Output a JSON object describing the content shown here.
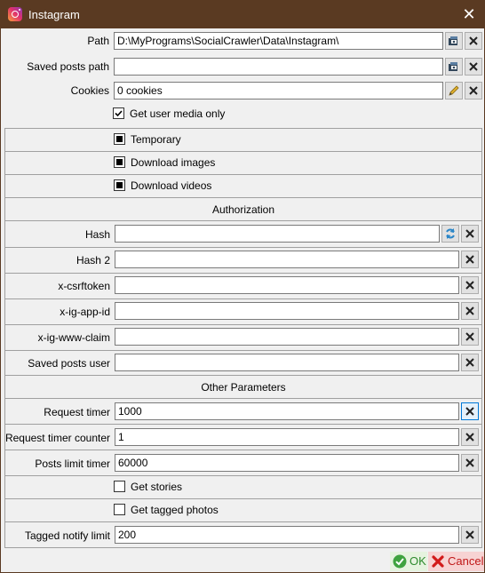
{
  "window": {
    "title": "Instagram",
    "close_label": "✕"
  },
  "fields": {
    "path": {
      "label": "Path",
      "value": "D:\\MyPrograms\\SocialCrawler\\Data\\Instagram\\"
    },
    "saved_posts_path": {
      "label": "Saved posts path",
      "value": ""
    },
    "cookies": {
      "label": "Cookies",
      "value": "0 cookies"
    },
    "hash": {
      "label": "Hash",
      "value": ""
    },
    "hash2": {
      "label": "Hash 2",
      "value": ""
    },
    "csrftoken": {
      "label": "x-csrftoken",
      "value": ""
    },
    "app_id": {
      "label": "x-ig-app-id",
      "value": ""
    },
    "www_claim": {
      "label": "x-ig-www-claim",
      "value": ""
    },
    "saved_posts_user": {
      "label": "Saved posts user",
      "value": ""
    },
    "request_timer": {
      "label": "Request timer",
      "value": "1000"
    },
    "request_timer_counter": {
      "label": "Request timer counter",
      "value": "1"
    },
    "posts_limit_timer": {
      "label": "Posts limit timer",
      "value": "60000"
    },
    "tagged_notify_limit": {
      "label": "Tagged notify limit",
      "value": "200"
    }
  },
  "checkboxes": {
    "get_user_media_only": {
      "label": "Get user media only",
      "state": "checked"
    },
    "temporary": {
      "label": "Temporary",
      "state": "indeterminate"
    },
    "download_images": {
      "label": "Download images",
      "state": "indeterminate"
    },
    "download_videos": {
      "label": "Download videos",
      "state": "indeterminate"
    },
    "get_stories": {
      "label": "Get stories",
      "state": "unchecked"
    },
    "get_tagged_photos": {
      "label": "Get tagged photos",
      "state": "unchecked"
    }
  },
  "sections": {
    "authorization": "Authorization",
    "other_parameters": "Other Parameters"
  },
  "footer": {
    "ok_label": "OK",
    "cancel_label": "Cancel"
  },
  "icons": {
    "open": "folder-open-icon",
    "clear": "clear-icon",
    "edit": "pencil-icon",
    "refresh": "refresh-icon",
    "ok": "ok-check-icon",
    "cancel": "cancel-x-icon"
  },
  "colors": {
    "titlebar": "#5a3a22",
    "ok_bg": "#e6f3df",
    "ok_text": "#2e8b2e",
    "cancel_bg": "#f7d3d3",
    "cancel_text": "#c01818",
    "focus": "#0078d7"
  }
}
